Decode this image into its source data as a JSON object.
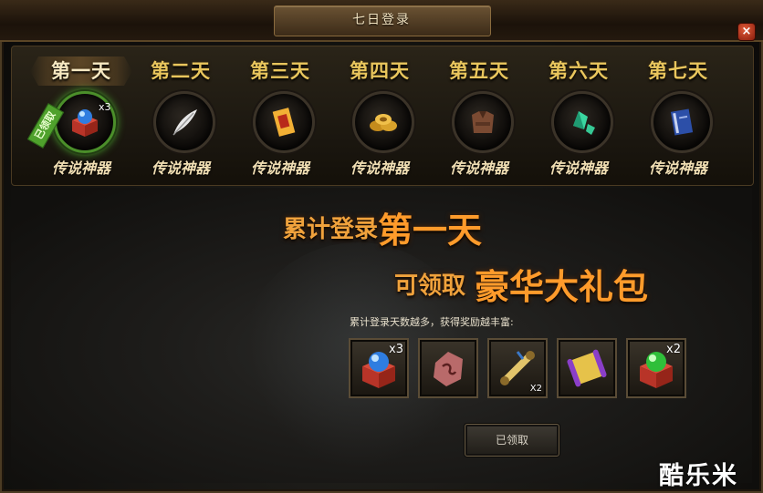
{
  "window": {
    "title": "七日登录",
    "close_label": "×"
  },
  "days": [
    {
      "label": "第一天",
      "item_name": "传说神器",
      "icon": "blue-gem-chest-icon",
      "quantity": "x3",
      "claimed_tag": "已领取",
      "active": true
    },
    {
      "label": "第二天",
      "item_name": "传说神器",
      "icon": "white-feather-icon"
    },
    {
      "label": "第三天",
      "item_name": "传说神器",
      "icon": "red-talisman-icon"
    },
    {
      "label": "第四天",
      "item_name": "传说神器",
      "icon": "gold-coins-icon"
    },
    {
      "label": "第五天",
      "item_name": "传说神器",
      "icon": "leather-armor-icon"
    },
    {
      "label": "第六天",
      "item_name": "传说神器",
      "icon": "green-crystal-icon"
    },
    {
      "label": "第七天",
      "item_name": "传说神器",
      "icon": "blue-book-icon"
    }
  ],
  "main": {
    "headline_prefix": "累计登录",
    "headline_day": "第一天",
    "headline2_prefix": "可领取",
    "headline2_reward": "豪华大礼包",
    "subtext": "累计登录天数越多，获得奖励越丰富:",
    "rewards": [
      {
        "icon": "blue-gem-chest-icon",
        "quantity": "x3"
      },
      {
        "icon": "pink-rune-stone-icon",
        "quantity": ""
      },
      {
        "icon": "scroll-icon",
        "quantity": "X2"
      },
      {
        "icon": "golden-scroll-icon",
        "quantity": ""
      },
      {
        "icon": "green-gem-chest-icon",
        "quantity": "x2"
      }
    ],
    "claim_button": "已领取"
  },
  "watermark": "酷乐米",
  "colors": {
    "accent_gold": "#e9c65d",
    "headline_orange": "#ff9b2b",
    "claimed_green": "#4fa12c"
  }
}
